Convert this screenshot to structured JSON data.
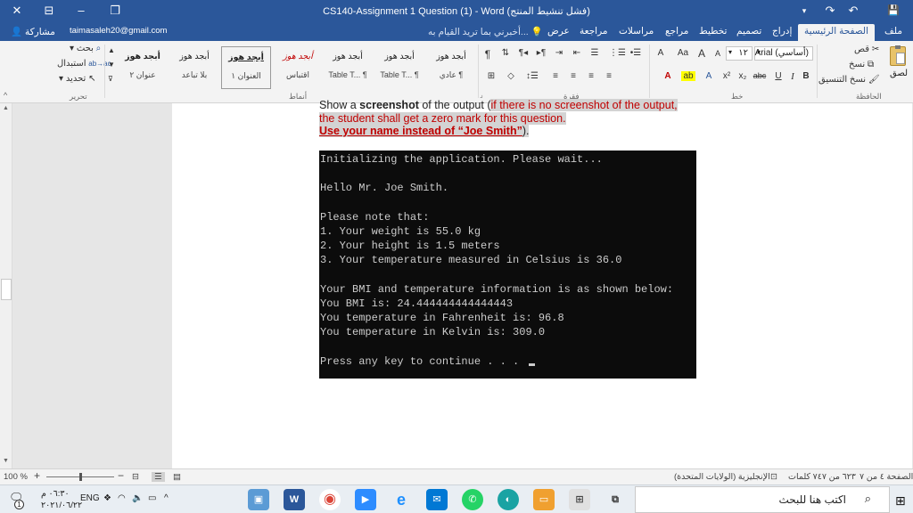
{
  "title_bar": {
    "title": "CS140-Assignment 1 Question (1)  -  Word (فشل تنشيط المنتج)",
    "minimize": "‒",
    "restore": "❐",
    "close": "✕",
    "options": "⊟",
    "save": "💾",
    "undo": "↶",
    "redo": "↷"
  },
  "ribbon_tabs": {
    "file": "ملف",
    "home": "الصفحة الرئيسية",
    "insert": "إدراج",
    "design": "تصميم",
    "layout": "تخطيط",
    "references": "مراجع",
    "mailings": "مراسلات",
    "review": "مراجعة",
    "view": "عرض",
    "tell_me": "أخبرني بما تريد القيام به...",
    "account": "taimasaleh20@gmail.com",
    "share": "مشاركة"
  },
  "ribbon": {
    "clipboard": {
      "paste": "لصق",
      "cut": "قص",
      "copy": "نسخ",
      "format_painter": "نسخ التنسيق",
      "label": "الحافظة"
    },
    "font": {
      "font_name": "Arial (أساسي)",
      "font_size": "١٢",
      "label": "خط",
      "bold": "B",
      "italic": "I",
      "underline": "U",
      "strike": "abc",
      "subscript": "x₂",
      "superscript": "x²",
      "grow": "A",
      "shrink": "A",
      "case": "Aa",
      "clear": "A",
      "highlight": "ab",
      "color": "A"
    },
    "paragraph": {
      "label": "فقرة",
      "pilcrow": "¶"
    },
    "styles": {
      "label": "أنماط",
      "items": [
        {
          "sample": "أبجد هوز",
          "name": "عادي ¶"
        },
        {
          "sample": "أبجد هوز",
          "name": "Table T... ¶"
        },
        {
          "sample": "أبجد هوز",
          "name": "Table T... ¶"
        },
        {
          "sample": "أبجد هوز",
          "name": "اقتباس"
        },
        {
          "sample": "أبجد هوز",
          "name": "العنوان ١"
        },
        {
          "sample": "أبجد هوز",
          "name": "بلا تباعد"
        },
        {
          "sample": "أبجد هوز",
          "name": "عنوان ٢"
        }
      ]
    },
    "editing": {
      "find": "بحث",
      "replace": "استبدال",
      "select": "تحديد",
      "label": "تحرير"
    }
  },
  "document": {
    "line1_pre": "Show a ",
    "line1_bold": "screenshot",
    "line1_post": " of the output (",
    "line1_red": "if there is no screenshot of the output,",
    "line2": "the student shall get a zero mark for this question.",
    "line3_red": "Use your name instead of “Joe Smith”",
    "line3_post": ")."
  },
  "console": {
    "lines": [
      "Initializing the application. Please wait...",
      "",
      "Hello Mr. Joe Smith.",
      "",
      "Please note that:",
      "1. Your weight is 55.0 kg",
      "2. Your height is 1.5 meters",
      "3. Your temperature measured in Celsius is 36.0",
      "",
      "Your BMI and temperature information is as shown below:",
      "You BMI is: 24.444444444444443",
      "You temperature in Fahrenheit is: 96.8",
      "You temperature in Kelvin is: 309.0",
      "",
      "Press any key to continue . . . "
    ]
  },
  "status_bar": {
    "page": "الصفحة ٤ من ٧",
    "words": "٦٢٣ من ٧٤٧ كلمات",
    "language": "الإنجليزية (الولايات المتحدة)",
    "zoom": "100 %",
    "zoom_level": 0.5
  },
  "taskbar": {
    "search_placeholder": "اكتب هنا للبحث",
    "time": "٠٦:٣٠ م",
    "date": "٢٠٢١/٠٦/٢٢",
    "lang": "ENG",
    "notif_count": "1",
    "word_label": "W"
  },
  "colors": {
    "word_blue": "#2b579a",
    "console_bg": "#0c0c0c",
    "console_fg": "#cccccc",
    "red_text": "#c00000"
  }
}
